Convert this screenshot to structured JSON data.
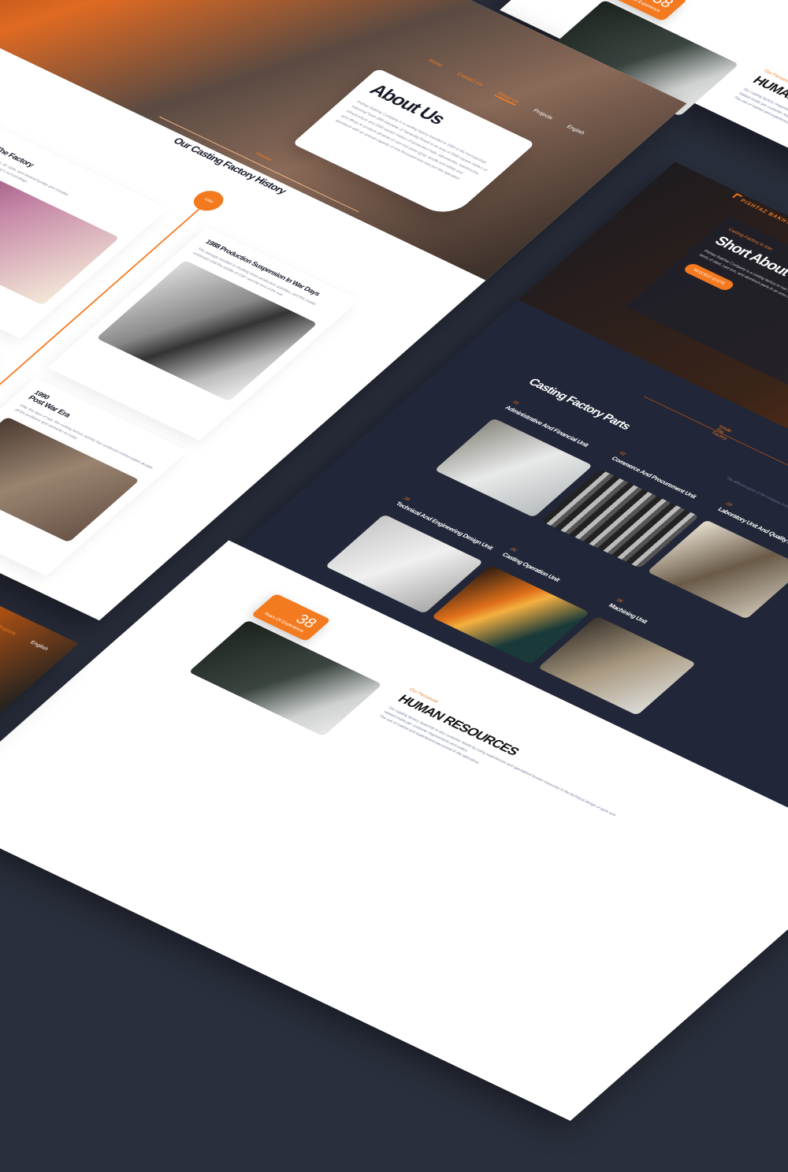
{
  "colors": {
    "accent": "#f47a20",
    "navy": "#212638",
    "background": "#2a2f3d"
  },
  "nav": {
    "items": [
      "Home",
      "Contact Us",
      "About Us",
      "Projects",
      "English"
    ]
  },
  "about": {
    "title": "About Us",
    "text": "Pishtaz Bakhtar Company is a casting factory founded in 1984 in the Kermanshah Industrial Town (fifth kilometer of Sanandaj Road) in an area of 5000 square meters of infrastructure and 2000 square meters of production halls, laboratories, warehouses, and offices to produce all kinds of cast iron parts (gray, ductile and white) and aluminum with an annual capacity of one thousand tons was put into operation."
  },
  "timeline": {
    "label": "Timeline",
    "title": "Our Casting Factory History",
    "marker": "1984",
    "items": [
      {
        "year": "1984",
        "title": "Establishment Of The Factory",
        "text": "This time coincided with the days of the war, air raids, and several bombs and missiles hitting the city of Kermanshah and the company's surroundings."
      },
      {
        "year": "1988",
        "title": "Production Suspension In War Days",
        "text": "The damage resulted in shutting down production activities, and this matter continued until the middle of 1367 and the end of the war."
      },
      {
        "year": "1990",
        "title": "Post War Era",
        "text": "After the days of war, the casting factory activity has continued uninterrupted despite all the problems and obstacles to today."
      }
    ]
  },
  "company": {
    "logo": "PISHTAZ BAKHTAR",
    "kicker": "Casting Factory In Iran",
    "title": "Short About The Company",
    "text": "Pishtaz Bakhtar Company is a casting factory in Iran in the industrial city of Kermanshah, started its activity in 1984 in the casting of kinds of steel, cast iron, and aluminum parts in an area of 5000 square meters and about 2000 square meters of halls infrastructure.",
    "button": "REQUEST QUOTE"
  },
  "parts": {
    "title": "Casting Factory Parts",
    "kicker": "Inside The Factory",
    "desc": "The different parts of the company include the following",
    "items": [
      {
        "num": ".01",
        "title": "Administrative And Financial Unit"
      },
      {
        "num": ".02",
        "title": "Commerce And Procurement Unit"
      },
      {
        "num": ".03",
        "title": "Laboratory Unit And Quality Assurance"
      },
      {
        "num": ".04",
        "title": "Technical And Engineering Design Unit"
      },
      {
        "num": ".05",
        "title": "Casting Operation Unit"
      },
      {
        "num": ".06",
        "title": "Machining Unit"
      }
    ]
  },
  "hr": {
    "years": "38",
    "years_label": "Years Of Experience",
    "kicker": "Our Personnel",
    "title": "HUMAN RESOURCES",
    "text1": "Our casting factory responds to any customer needs by using experienced and specialized human resources in the technical design of parts and related molds per customer requirements and orders.",
    "text2": "The use of trained and experienced personnel in the laboratory..."
  }
}
